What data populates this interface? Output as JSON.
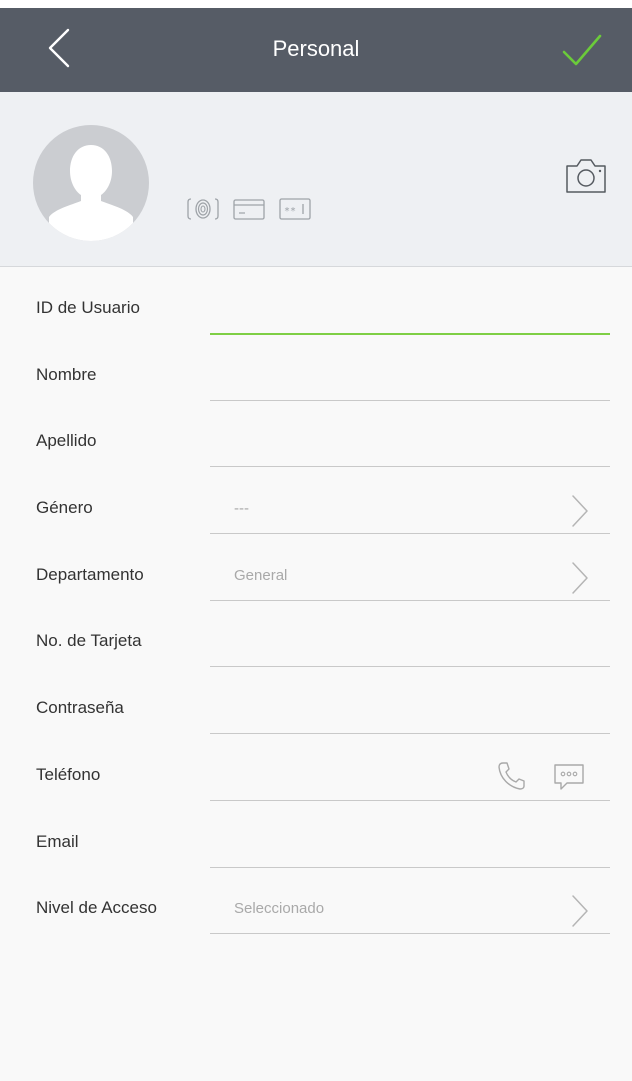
{
  "header": {
    "title": "Personal"
  },
  "colors": {
    "header_bg": "#565c66",
    "confirm_check": "#6bcb3a",
    "active_underline": "#7fcf45",
    "profile_bg": "#eef0f3"
  },
  "icons": {
    "back": "chevron-left-icon",
    "confirm": "checkmark-icon",
    "camera": "camera-icon",
    "fingerprint": "fingerprint-icon",
    "card": "card-icon",
    "password": "password-icon",
    "phone": "phone-icon",
    "sms": "sms-icon",
    "chevron": "chevron-right-icon"
  },
  "form": {
    "user_id": {
      "label": "ID de Usuario",
      "value": ""
    },
    "first_name": {
      "label": "Nombre",
      "value": ""
    },
    "last_name": {
      "label": "Apellido",
      "value": ""
    },
    "gender": {
      "label": "Género",
      "value": "---"
    },
    "department": {
      "label": "Departamento",
      "value": "General"
    },
    "card_no": {
      "label": "No. de Tarjeta",
      "value": ""
    },
    "password": {
      "label": "Contraseña",
      "value": ""
    },
    "phone": {
      "label": "Teléfono",
      "value": ""
    },
    "email": {
      "label": "Email",
      "value": ""
    },
    "access_level": {
      "label": "Nivel de Acceso",
      "value": "Seleccionado"
    }
  }
}
